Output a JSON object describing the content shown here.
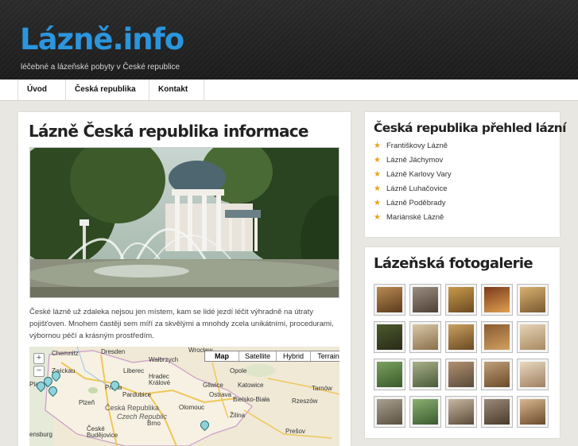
{
  "site": {
    "logo": "Lázně.info",
    "tagline": "léčebné a lázeňské pobyty v České republice"
  },
  "nav": {
    "items": [
      "Úvod",
      "Česká republika",
      "Kontakt"
    ]
  },
  "main": {
    "title": "Lázně Česká republika informace",
    "intro": "České lázně už zdaleka nejsou jen místem, kam se lidé jezdí léčit výhradně na útraty pojišťoven. Mnohem častěji sem míří za skvělými a mnohdy zcela unikátními, procedurami, výbornou péčí a krásným prostředím."
  },
  "map": {
    "types": [
      "Map",
      "Satellite",
      "Hybrid",
      "Terrain"
    ],
    "active_type": "Map",
    "zoom_in": "+",
    "zoom_out": "−",
    "labels": {
      "chemnitz": "Chemnitz",
      "dresden": "Dresden",
      "walbrzych": "Wałbrzych",
      "wroclaw": "Wrocław",
      "opole": "Opole",
      "zwickau": "Zwickau",
      "liberec": "Liberec",
      "hradec": "Hradec",
      "kralove": "Králové",
      "gliwice": "Gliwice",
      "katowice": "Katowice",
      "praha": "Praha",
      "pardubice": "Pardubice",
      "ostrava": "Ostrava",
      "tarnow": "Tarnów",
      "plzen": "Plzeň",
      "olomouc": "Olomouc",
      "bielsko": "Bielsko-Biała",
      "rzeszow": "Rzeszów",
      "cr": "Česká Republika",
      "czech": "Czech Republic",
      "brno": "Brno",
      "zilina": "Žilina",
      "presov": "Prešov",
      "ceske": "České",
      "budejovice": "Budějovice",
      "plauen": "Plauen",
      "regensburg": "ensburg"
    }
  },
  "sidebar": {
    "spas_title": "Česká republika přehled lázní",
    "spas": [
      "Františkovy Lázně",
      "Lázně Jáchymov",
      "Lázně Karlovy Vary",
      "Lázně Luhačovice",
      "Lázně Poděbrady",
      "Mariánské Lázně"
    ],
    "gallery_title": "Lázeňská fotogalerie"
  },
  "colors": {
    "logo": "#2b95dd",
    "header_bg": "#222222",
    "star": "#e8a317",
    "page_bg": "#e9e7e2"
  }
}
